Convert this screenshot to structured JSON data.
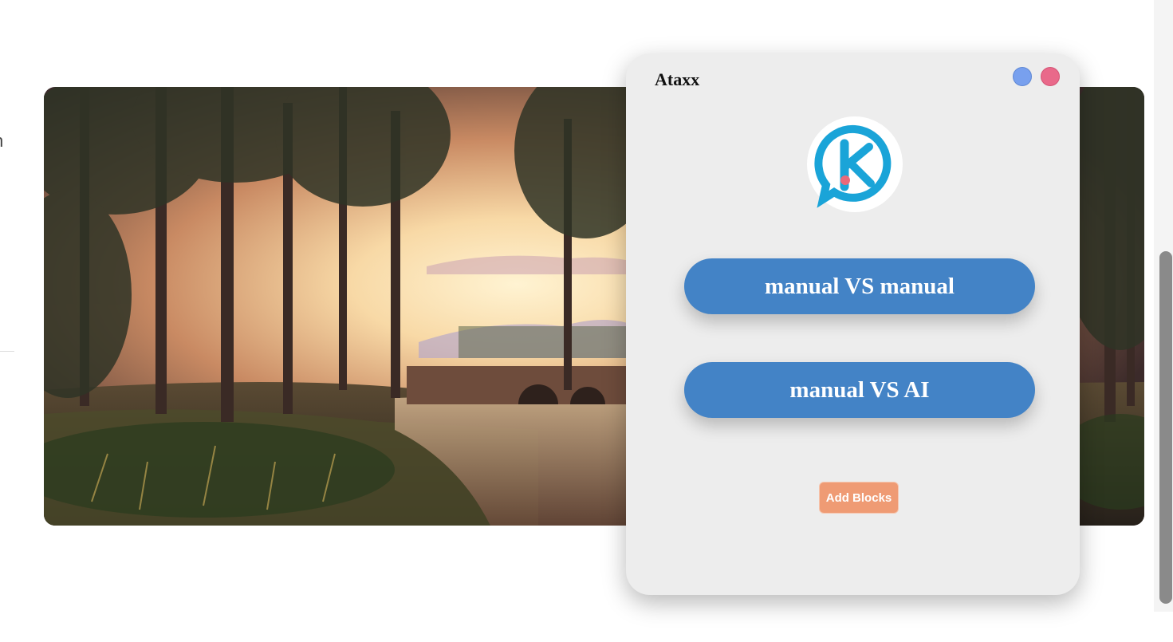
{
  "page": {
    "edge_text": "n"
  },
  "background_image": {
    "icon": "forest-sunset-landscape"
  },
  "window": {
    "title": "Ataxx",
    "minimize_icon": "blue-circle-icon",
    "close_icon": "pink-circle-icon",
    "logo_icon": "k-chat-logo-icon",
    "buttons": {
      "manual_vs_manual": "manual VS manual",
      "manual_vs_ai": "manual VS AI",
      "add_blocks": "Add Blocks"
    },
    "colors": {
      "window_bg": "#ededed",
      "mode_button": "#4383c6",
      "add_blocks_button": "#ef9b74",
      "minimize": "#78a0ee",
      "close": "#e9698a",
      "logo_blue": "#1aa4d8",
      "logo_dot": "#e9697a"
    }
  }
}
